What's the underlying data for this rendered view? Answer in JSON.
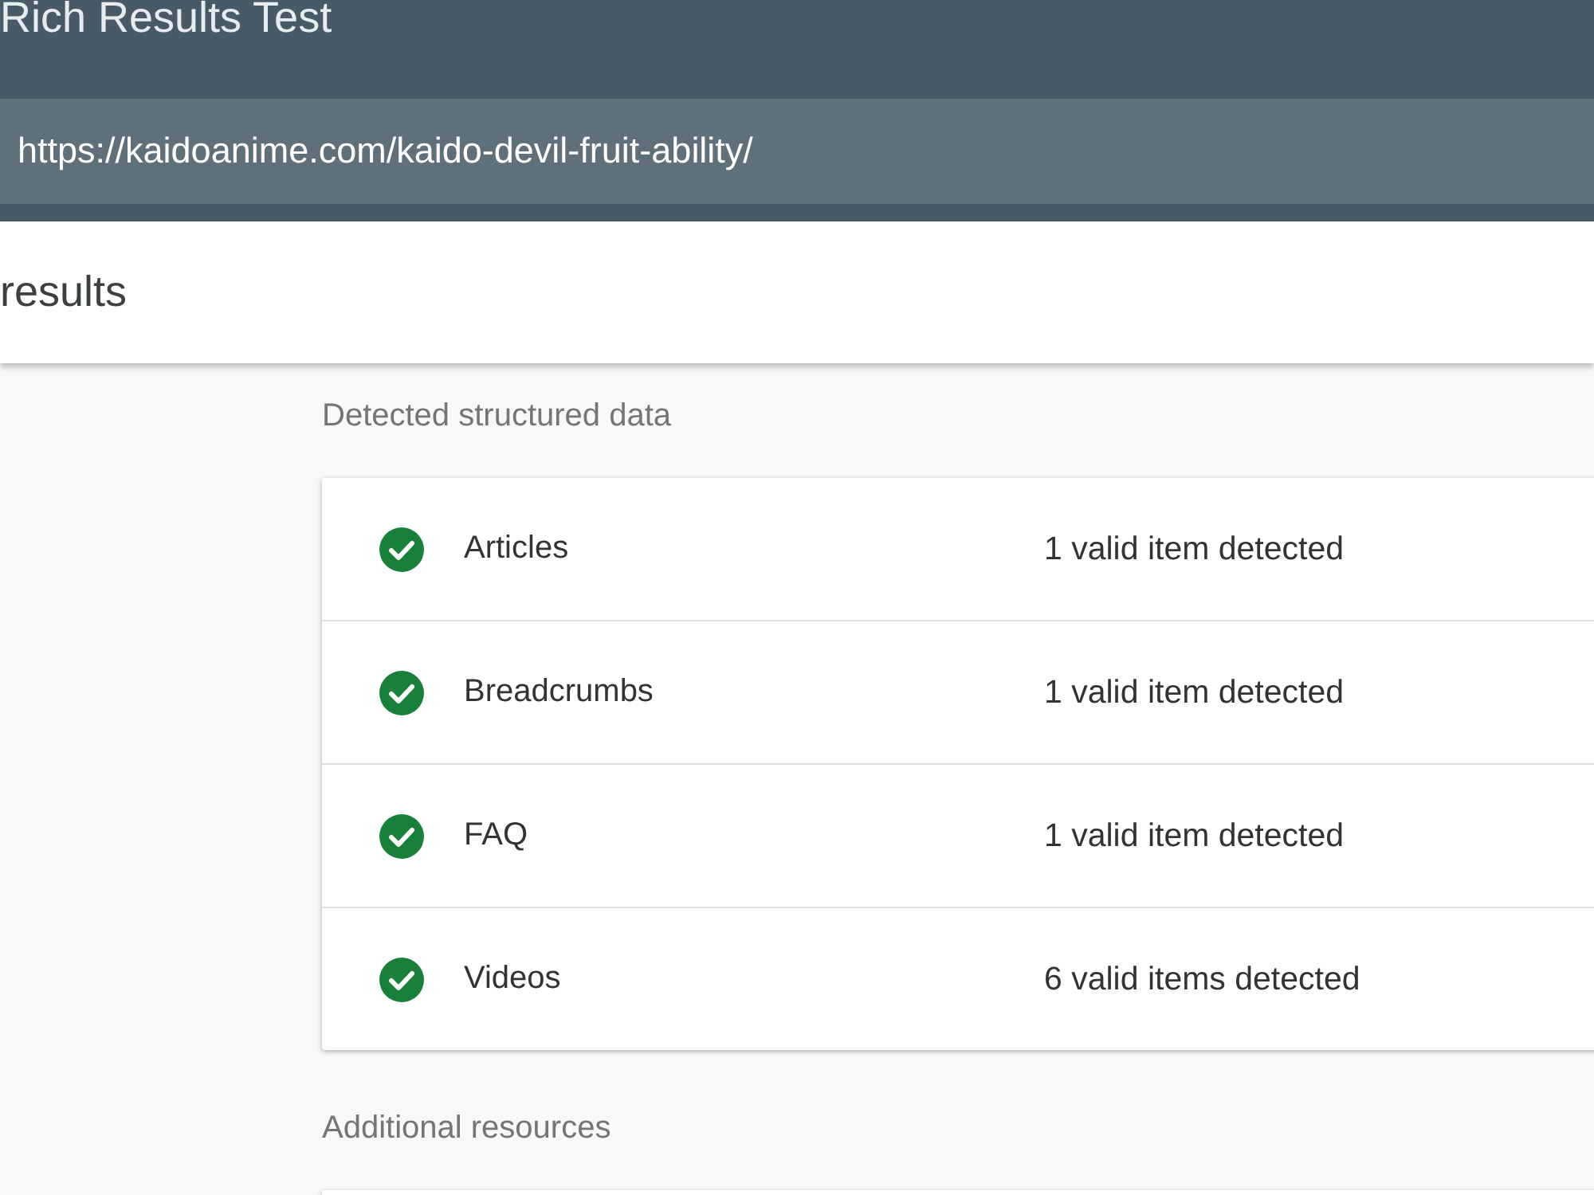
{
  "header": {
    "title": "Rich Results Test",
    "url": "https://kaidoanime.com/kaido-devil-fruit-ability/"
  },
  "results_bar": {
    "title": "results"
  },
  "detected_section": {
    "heading": "Detected structured data",
    "items": [
      {
        "name": "Articles",
        "valid": true,
        "count": "1 valid item detected"
      },
      {
        "name": "Breadcrumbs",
        "valid": true,
        "count": "1 valid item detected"
      },
      {
        "name": "FAQ",
        "valid": true,
        "count": "1 valid item detected"
      },
      {
        "name": "Videos",
        "valid": true,
        "count": "6 valid items detected"
      }
    ]
  },
  "additional_section": {
    "heading": "Additional resources"
  }
}
